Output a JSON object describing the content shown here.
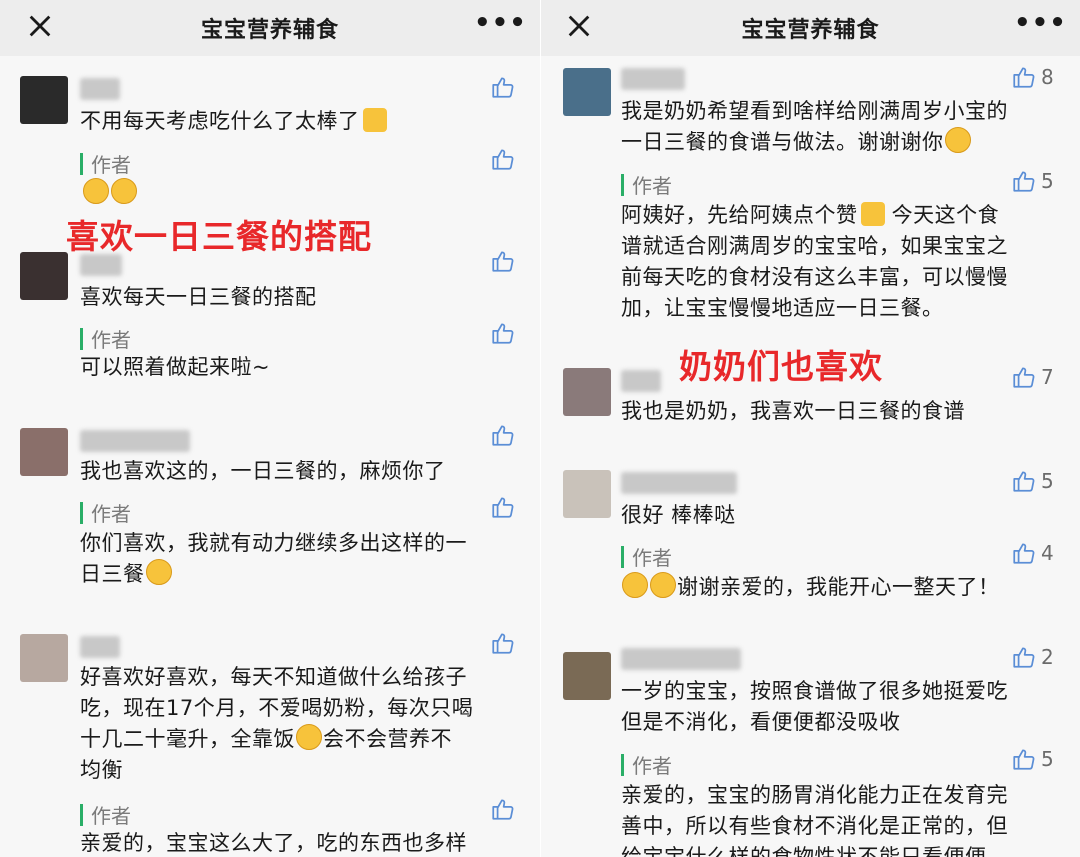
{
  "left": {
    "nav": {
      "title": "宝宝营养辅食"
    },
    "overlay": "喜欢一日三餐的搭配",
    "comments": [
      {
        "text": "不用每天考虑吃什么了太棒了",
        "reply_label": "作者",
        "reply_text": ""
      },
      {
        "text": "喜欢每天一日三餐的搭配",
        "reply_label": "作者",
        "reply_text": "可以照着做起来啦~"
      },
      {
        "text": "我也喜欢这的，一日三餐的，麻烦你了",
        "reply_label": "作者",
        "reply_text_1": "你们喜欢，我就有动力继续多出这样的一",
        "reply_text_2": "日三餐"
      },
      {
        "text_1": "好喜欢好喜欢，每天不知道做什么给孩子",
        "text_2": "吃，现在17个月，不爱喝奶粉，每次只喝",
        "text_3": "十几二十毫升，全靠饭",
        "text_3b": "会不会营养不",
        "text_4": "均衡",
        "reply_label": "作者",
        "reply_text": "亲爱的，宝宝这么大了，吃的东西也多样"
      }
    ]
  },
  "right": {
    "nav": {
      "title": "宝宝营养辅食"
    },
    "overlay": "奶奶们也喜欢",
    "comments": [
      {
        "likes": "8",
        "text_1": "我是奶奶希望看到啥样给刚满周岁小宝的",
        "text_2": "一日三餐的食谱与做法。谢谢谢你",
        "reply_label": "作者",
        "reply_likes": "5",
        "reply_1": "阿姨好，先给阿姨点个赞",
        "reply_1b": " 今天这个食",
        "reply_2": "谱就适合刚满周岁的宝宝哈，如果宝宝之",
        "reply_3": "前每天吃的食材没有这么丰富，可以慢慢",
        "reply_4": "加，让宝宝慢慢地适应一日三餐。"
      },
      {
        "likes": "7",
        "text": "我也是奶奶，我喜欢一日三餐的食谱"
      },
      {
        "likes": "5",
        "text": "很好 棒棒哒",
        "reply_label": "作者",
        "reply_likes": "4",
        "reply_text": "谢谢亲爱的，我能开心一整天了！"
      },
      {
        "likes": "2",
        "text_1": "一岁的宝宝，按照食谱做了很多她挺爱吃",
        "text_2": "但是不消化，看便便都没吸收",
        "reply_label": "作者",
        "reply_likes": "5",
        "reply_1": "亲爱的，宝宝的肠胃消化能力正在发育完",
        "reply_2": "善中，所以有些食材不消化是正常的，但",
        "reply_3": "给宝宝什么样的食物性状不能只看便便"
      }
    ]
  },
  "colors": {
    "accent_green": "#2aae67",
    "overlay_red": "#e8282a",
    "like_blue": "#5b8ed6"
  }
}
